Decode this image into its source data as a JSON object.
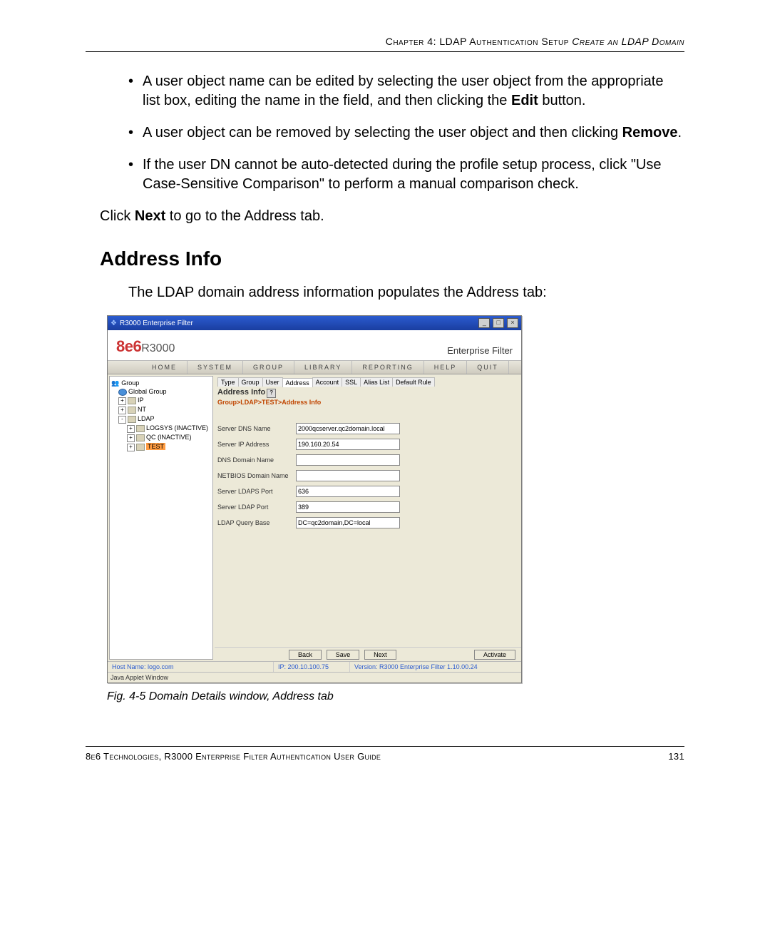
{
  "header": {
    "chapter": "Chapter 4: LDAP Authentication Setup",
    "section": "  Create an LDAP Domain"
  },
  "bullets": {
    "b1": "A user object name can be edited by selecting the user object from the appropriate list box, editing the name in the field, and then clicking the ",
    "b1_bold": "Edit",
    "b1_after": " button.",
    "b2": "A user object can be removed by selecting the user object and then clicking ",
    "b2_bold": "Remove",
    "b2_after": ".",
    "b3": "If the user DN cannot be auto-detected during the profile setup process, click \"Use Case-Sensitive Comparison\" to perform a manual comparison check."
  },
  "click_next_pre": "Click ",
  "click_next_bold": "Next",
  "click_next_post": " to go to the Address tab.",
  "heading": "Address Info",
  "intro": "The LDAP domain address information populates the Address tab:",
  "win": {
    "title": "R3000 Enterprise Filter",
    "logo_eight": "8e6",
    "logo_r": "R3000",
    "ef": "Enterprise Filter",
    "menu": {
      "home": "HOME",
      "system": "SYSTEM",
      "group": "GROUP",
      "library": "LIBRARY",
      "reporting": "REPORTING",
      "help": "HELP",
      "quit": "QUIT"
    },
    "tree": {
      "root": "Group",
      "global": "Global Group",
      "ip": "IP",
      "nt": "NT",
      "ldap": "LDAP",
      "logsys": "LOGSYS (INACTIVE)",
      "qc": "QC (INACTIVE)",
      "test": "TEST"
    },
    "tabs": {
      "type": "Type",
      "group": "Group",
      "user": "User",
      "address": "Address",
      "account": "Account",
      "ssl": "SSL",
      "alias": "Alias List",
      "default": "Default Rule"
    },
    "panel_title": "Address Info",
    "breadcrumb": "Group>LDAP>TEST>Address Info",
    "fields": {
      "server_dns_label": "Server DNS Name",
      "server_dns_value": "2000qcserver.qc2domain.local",
      "server_ip_label": "Server IP Address",
      "server_ip_value": "190.160.20.54",
      "dns_domain_label": "DNS Domain Name",
      "dns_domain_value": "",
      "netbios_label": "NETBIOS Domain Name",
      "netbios_value": "",
      "ldaps_label": "Server LDAPS Port",
      "ldaps_value": "636",
      "ldap_label": "Server LDAP Port",
      "ldap_value": "389",
      "query_label": "LDAP Query Base",
      "query_value": "DC=qc2domain,DC=local"
    },
    "buttons": {
      "back": "Back",
      "save": "Save",
      "next": "Next",
      "activate": "Activate"
    },
    "status": {
      "host": "Host Name: logo.com",
      "ip": "IP: 200.10.100.75",
      "version": "Version: R3000 Enterprise Filter 1.10.00.24"
    },
    "java": "Java Applet Window"
  },
  "caption": "Fig. 4-5  Domain Details window, Address tab",
  "footer": {
    "left": "8e6 Technologies, R3000 Enterprise Filter Authentication User Guide",
    "right": "131"
  }
}
